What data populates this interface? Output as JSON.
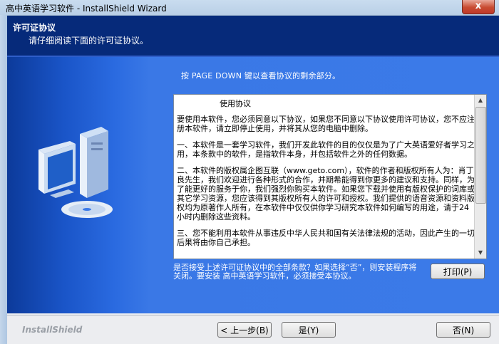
{
  "window": {
    "title": "高中英语学习软件 - InstallShield Wizard",
    "close_glyph": "x"
  },
  "header": {
    "title": "许可证协议",
    "subtitle": "请仔细阅读下面的许可证协议。"
  },
  "instruction": "按 PAGE DOWN 键以查看协议的剩余部分。",
  "license": {
    "heading": "使用协议",
    "paragraphs": [
      "要使用本软件，您必须同意以下协议，如果您不同意以下协议使用许可协议，您不应注册本软件，请立即停止使用，并将其从您的电脑中删除。",
      "一、本软件是一套学习软件，我们开发此软件的目的仅仅是为了广大英语爱好者学习之用，本条款中的软件，是指软件本身，并包括软件之外的任何数据。",
      "二、本软件的版权属企图互联（www.geto.com），软件的作者和版权所有人为：肖丁良先生，我们欢迎进行各种形式的合作，并期希能得到你更多的建议和支持。同样，为了能更好的服务于你，我们强烈你购买本软件。如果您下载并使用有版权保护的词库或其它学习资源，您应该得到其版权所有人的许可和授权。我们提供的语音资源和资料版权均为原著作人所有，在本软件中仅仅供你学习研究本软件如何编写的用途，请于24小时内删除这些资料。",
      "三、您不能利用本软件从事违反中华人民共和国有关法律法规的活动，因此产生的一切后果将由你自己承担。"
    ],
    "scroll_up_glyph": "▲",
    "scroll_down_glyph": "▼"
  },
  "question": "是否接受上述许可证协议中的全部条款？如果选择“否”，则安装程序将关闭。要安装 高中英语学习软件，必须接受本协议。",
  "buttons": {
    "print": "打印(P)",
    "back": "< 上一步(B)",
    "yes": "是(Y)",
    "no": "否(N)"
  },
  "footer": {
    "brand": "InstallShield"
  }
}
